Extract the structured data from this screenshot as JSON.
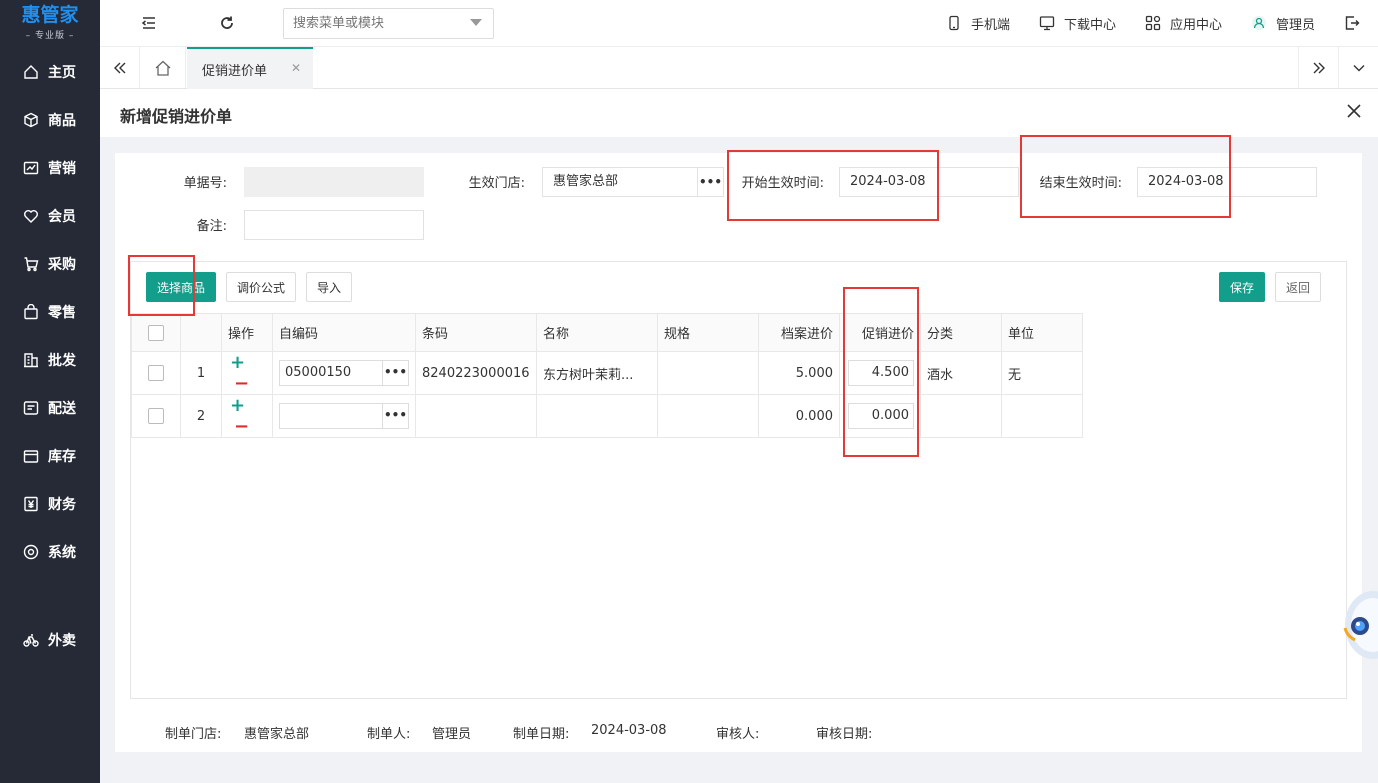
{
  "brand": {
    "name": "惠管家",
    "edition": "专业版"
  },
  "sidebar": {
    "items": [
      {
        "label": "主页",
        "icon": "home-icon"
      },
      {
        "label": "商品",
        "icon": "cube-icon"
      },
      {
        "label": "营销",
        "icon": "chart-icon"
      },
      {
        "label": "会员",
        "icon": "heart-icon"
      },
      {
        "label": "采购",
        "icon": "cart-icon"
      },
      {
        "label": "零售",
        "icon": "bag-icon"
      },
      {
        "label": "批发",
        "icon": "building-icon"
      },
      {
        "label": "配送",
        "icon": "truck-icon"
      },
      {
        "label": "库存",
        "icon": "box-icon"
      },
      {
        "label": "财务",
        "icon": "yen-icon"
      },
      {
        "label": "系统",
        "icon": "gear-icon"
      },
      {
        "label": "外卖",
        "icon": "bike-icon"
      }
    ]
  },
  "topbar": {
    "search_placeholder": "搜索菜单或模块",
    "mobile": "手机端",
    "download": "下载中心",
    "apps": "应用中心",
    "user": "管理员"
  },
  "tabs": {
    "active": "促销进价单"
  },
  "page": {
    "title": "新增促销进价单"
  },
  "form": {
    "doc_no_label": "单据号:",
    "doc_no_value": "",
    "store_label": "生效门店:",
    "store_value": "惠管家总部",
    "start_label": "开始生效时间:",
    "start_value": "2024-03-08",
    "end_label": "结束生效时间:",
    "end_value": "2024-03-08",
    "remark_label": "备注:",
    "remark_value": ""
  },
  "toolbar": {
    "select_goods": "选择商品",
    "price_formula": "调价公式",
    "import": "导入",
    "save": "保存",
    "back": "返回"
  },
  "table": {
    "headers": [
      "操作",
      "自编码",
      "条码",
      "名称",
      "规格",
      "档案进价",
      "促销进价",
      "分类",
      "单位"
    ],
    "rows": [
      {
        "no": "1",
        "code": "05000150",
        "barcode": "8240223000016",
        "name": "东方树叶茉莉...",
        "spec": "",
        "cost": "5.000",
        "promo": "4.500",
        "category": "酒水",
        "unit": "无"
      },
      {
        "no": "2",
        "code": "",
        "barcode": "",
        "name": "",
        "spec": "",
        "cost": "0.000",
        "promo": "0.000",
        "category": "",
        "unit": ""
      }
    ]
  },
  "footer": {
    "store_label": "制单门店:",
    "store_value": "惠管家总部",
    "maker_label": "制单人:",
    "maker_value": "管理员",
    "date_label": "制单日期:",
    "date_value": "2024-03-08",
    "auditor_label": "审核人:",
    "audit_date_label": "审核日期:"
  },
  "colors": {
    "sidebar_bg": "#252a36",
    "primary": "#129e8a",
    "highlight": "#e53935",
    "brand": "#1f8ff0"
  }
}
